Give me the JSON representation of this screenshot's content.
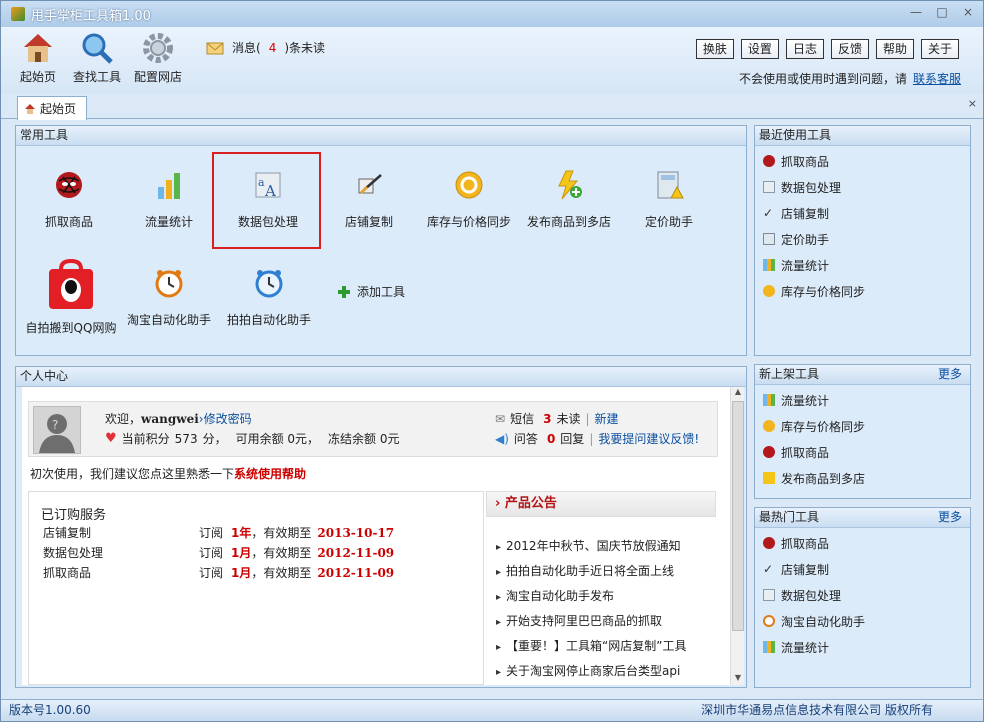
{
  "window": {
    "title": "甩手掌柜工具箱1.00",
    "min": "—",
    "max": "□",
    "close": "×"
  },
  "toolbar": {
    "home": "起始页",
    "find": "查找工具",
    "config": "配置网店"
  },
  "message": {
    "prefix": "消息(",
    "count": "4",
    "suffix": ")条未读"
  },
  "top_buttons": [
    "换肤",
    "设置",
    "日志",
    "反馈",
    "帮助",
    "关于"
  ],
  "help": {
    "text": "不会使用或使用时遇到问题，请",
    "link": "联系客服"
  },
  "tab": {
    "label": "起始页",
    "close": "×"
  },
  "common_tools": {
    "title": "常用工具",
    "items": [
      {
        "label": "抓取商品",
        "icon": "spider-icon"
      },
      {
        "label": "流量统计",
        "icon": "bar-chart-icon"
      },
      {
        "label": "数据包处理",
        "icon": "data-package-icon"
      },
      {
        "label": "店铺复制",
        "icon": "shop-copy-icon"
      },
      {
        "label": "库存与价格同步",
        "icon": "sync-icon"
      },
      {
        "label": "发布商品到多店",
        "icon": "publish-icon"
      },
      {
        "label": "定价助手",
        "icon": "calculator-icon"
      },
      {
        "label": "自拍搬到QQ网购",
        "icon": "qq-shop-icon"
      },
      {
        "label": "淘宝自动化助手",
        "icon": "alarm-clock-icon"
      },
      {
        "label": "拍拍自动化助手",
        "icon": "alarm-clock-blue-icon"
      }
    ],
    "add": "添加工具"
  },
  "recent": {
    "title": "最近使用工具",
    "items": [
      "抓取商品",
      "数据包处理",
      "店铺复制",
      "定价助手",
      "流量统计",
      "库存与价格同步"
    ]
  },
  "new_tools": {
    "title": "新上架工具",
    "more": "更多",
    "items": [
      "流量统计",
      "库存与价格同步",
      "抓取商品",
      "发布商品到多店"
    ]
  },
  "hot": {
    "title": "最热门工具",
    "more": "更多",
    "items": [
      "抓取商品",
      "店铺复制",
      "数据包处理",
      "淘宝自动化助手",
      "流量统计"
    ]
  },
  "personal": {
    "title": "个人中心",
    "welcome": "欢迎，",
    "user": "wangwei",
    "sep": "›",
    "change_pw": "修改密码",
    "points_label": "当前积分",
    "points": "573",
    "points_unit": "分，",
    "balance": "可用余额 0元，",
    "frozen": "冻结余额 0元",
    "sms_label": "短信",
    "sms_count": "3",
    "sms_unread": "未读",
    "sms_new": "新建",
    "qa_label": "问答",
    "qa_count": "0",
    "qa_reply": "回复",
    "qa_ask": "我要提问建议反馈!",
    "intro": "初次使用，我们建议您点这里熟悉一下",
    "intro_link": "系统使用帮助"
  },
  "services": {
    "title": "已订购服务",
    "rows": [
      {
        "name": "店铺复制",
        "sub": "订阅",
        "period": "1年",
        "mid": "，有效期至",
        "date": "2013-10-17"
      },
      {
        "name": "数据包处理",
        "sub": "订阅",
        "period": "1月",
        "mid": "，有效期至",
        "date": "2012-11-09"
      },
      {
        "name": "抓取商品",
        "sub": "订阅",
        "period": "1月",
        "mid": "，有效期至",
        "date": "2012-11-09"
      }
    ]
  },
  "news": {
    "title": "› 产品公告",
    "items": [
      "2012年中秋节、国庆节放假通知",
      "拍拍自动化助手近日将全面上线",
      "淘宝自动化助手发布",
      "开始支持阿里巴巴商品的抓取",
      "【重要！】工具箱“网店复制”工具",
      "关于淘宝网停止商家后台类型api"
    ]
  },
  "status": {
    "version": "版本号1.00.60",
    "copyright": "深圳市华通易点信息技术有限公司 版权所有"
  }
}
